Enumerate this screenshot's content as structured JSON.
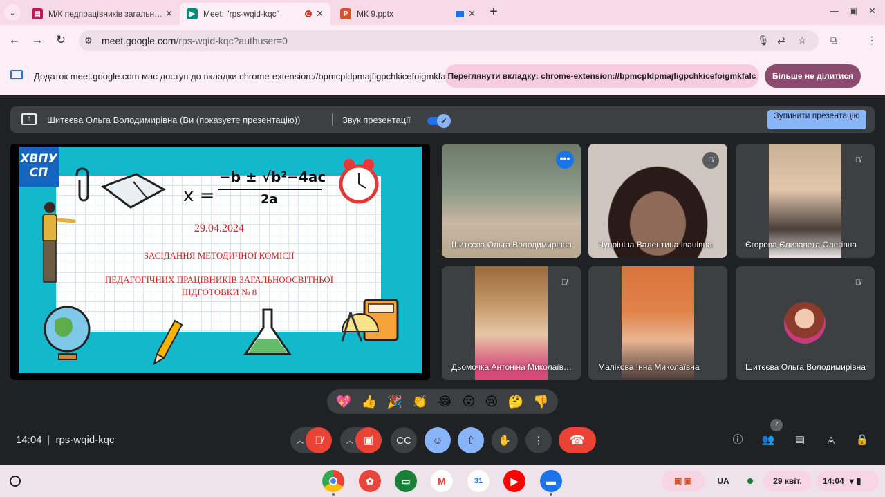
{
  "tabs": [
    {
      "title": "М/К педпрацівників загальн…",
      "favicon_color": "#c2185b"
    },
    {
      "title": "Meet: \"rps-wqid-kqc\"",
      "favicon_color": "#00897b"
    },
    {
      "title": "МК 9.pptx",
      "favicon_color": "#d35230"
    }
  ],
  "toolbar": {
    "url_host": "meet.google.com",
    "url_path": "/rps-wqid-kqc?authuser=0"
  },
  "infobar": {
    "message": "Додаток meet.google.com має доступ до вкладки chrome-extension://bpmcpldpmajfigpchkicefoigmkfalc",
    "view_tab_button": "Переглянути вкладку: chrome-extension://bpmcpldpmajfigpchkicefoigmkfalc",
    "stop_sharing_button": "Більше не ділитися"
  },
  "presenting_bar": {
    "presenter_text": "Шитєєва Ольга Володимирівна (Ви (показуєте презентацію))",
    "sound_label": "Звук презентації",
    "sound_on": true,
    "stop_button": "Зупинити презентацію"
  },
  "slide": {
    "logo": "ХВПУ СП",
    "formula_lhs": "x =",
    "formula_numerator": "−b ± √b²−4ac",
    "formula_denominator": "2a",
    "date": "29.04.2024",
    "line1": "ЗАСІДАННЯ МЕТОДИЧНОЇ КОМІСІЇ",
    "line2": "ПЕДАГОГІЧНИХ ПРАЦІВНИКІВ ЗАГАЛЬНООСВІТНЬОЇ",
    "line3": "ПІДГОТОВКИ № 8"
  },
  "participants": [
    {
      "name": "Шитєєва Ольга Володимирівна",
      "muted": false,
      "speaking": true
    },
    {
      "name": "Чупрініна Валентина Іванівна",
      "muted": true
    },
    {
      "name": "Єгорова Єлизавета Олегівна",
      "muted": true
    },
    {
      "name": "Дьомочка Антоніна Миколаївна",
      "muted": true
    },
    {
      "name": "Малікова Інна Миколаївна",
      "muted": false
    },
    {
      "name": "Шитєєва Ольга Володимирівна",
      "muted": true
    }
  ],
  "reactions": [
    "💖",
    "👍",
    "🎉",
    "👏",
    "😂",
    "😮",
    "😢",
    "🤔",
    "👎"
  ],
  "meeting": {
    "time": "14:04",
    "code": "rps-wqid-kqc",
    "participant_count": "7"
  },
  "shelf": {
    "locale": "UA",
    "date": "29 квіт.",
    "time": "14:04"
  },
  "icons": {
    "mic": "mic-off-icon",
    "camera": "camera-off-icon",
    "captions": "captions-icon",
    "emoji": "emoji-icon",
    "present": "present-icon",
    "hand": "raise-hand-icon",
    "more": "more-vert-icon",
    "end": "call-end-icon"
  },
  "colors": {
    "meet_bg": "#202124",
    "accent_blue": "#8ab4f8",
    "end_red": "#ea4335",
    "chrome_pink": "#f6dbe7"
  }
}
